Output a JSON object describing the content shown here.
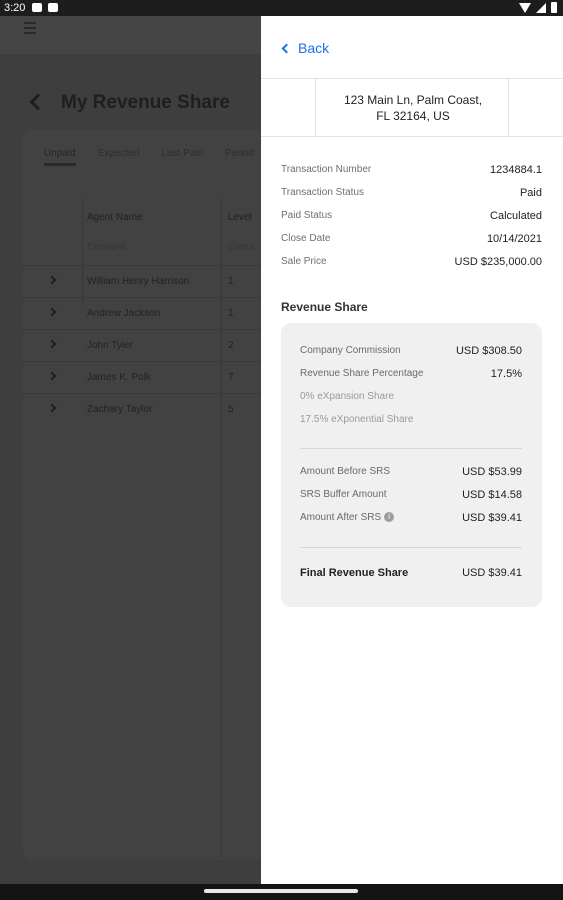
{
  "status_bar": {
    "time": "3:20"
  },
  "background": {
    "page_title": "My Revenue Share",
    "tabs": [
      "Unpaid",
      "Expected",
      "Last Paid",
      "Period"
    ],
    "columns": {
      "agent_name": "Agent Name",
      "level": "Level",
      "filter_placeholder": "Contains",
      "filter_placeholder_short": "Conta"
    },
    "rows": [
      {
        "name": "William Henry Harrison",
        "level": "1"
      },
      {
        "name": "Andrew Jackson",
        "level": "1"
      },
      {
        "name": "John Tyler",
        "level": "2"
      },
      {
        "name": "James K. Polk",
        "level": "7"
      },
      {
        "name": "Zachary Taylor",
        "level": "5"
      }
    ]
  },
  "panel": {
    "back_label": "Back",
    "address_line1": "123 Main Ln, Palm Coast,",
    "address_line2": "FL 32164, US",
    "details": [
      {
        "label": "Transaction Number",
        "value": "1234884.1"
      },
      {
        "label": "Transaction Status",
        "value": "Paid"
      },
      {
        "label": "Paid Status",
        "value": "Calculated"
      },
      {
        "label": "Close Date",
        "value": "10/14/2021"
      },
      {
        "label": "Sale Price",
        "value": "USD $235,000.00"
      }
    ],
    "revenue_share": {
      "title": "Revenue Share",
      "company_commission": {
        "label": "Company Commission",
        "value": "USD $308.50"
      },
      "share_percentage": {
        "label": "Revenue Share Percentage",
        "value": "17.5%"
      },
      "expansion_share": "0% eXpansion Share",
      "exponential_share": "17.5% eXponential Share",
      "amount_before_srs": {
        "label": "Amount Before SRS",
        "value": "USD $53.99"
      },
      "srs_buffer": {
        "label": "SRS Buffer Amount",
        "value": "USD $14.58"
      },
      "amount_after_srs": {
        "label": "Amount After SRS",
        "value": "USD $39.41"
      },
      "info_glyph": "i",
      "final": {
        "label": "Final Revenue Share",
        "value": "USD $39.41"
      }
    }
  }
}
